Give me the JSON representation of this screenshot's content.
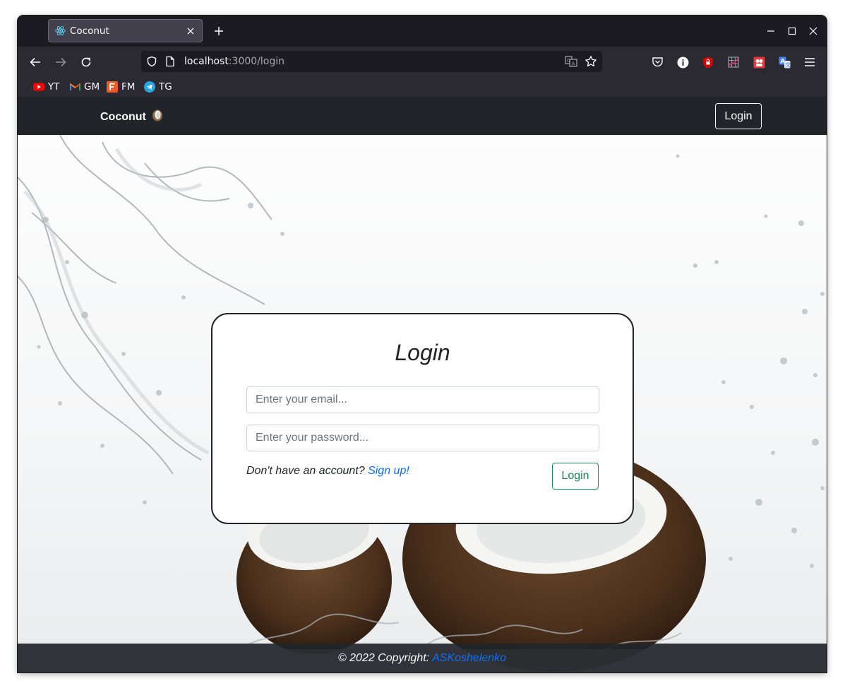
{
  "browser": {
    "tab": {
      "title": "Coconut",
      "favicon": "react-logo-icon"
    },
    "url": {
      "host": "localhost",
      "rest": ":3000/login"
    },
    "bookmarks": [
      {
        "label": "YT",
        "icon": "youtube-icon",
        "color": "#ff0000"
      },
      {
        "label": "GM",
        "icon": "gmail-icon",
        "color": "#ea4335"
      },
      {
        "label": "FM",
        "icon": "fm-icon",
        "color": "#f15a24"
      },
      {
        "label": "TG",
        "icon": "telegram-icon",
        "color": "#2aa3df"
      }
    ]
  },
  "app": {
    "brand": "Coconut",
    "nav_login": "Login",
    "card": {
      "title": "Login",
      "email_placeholder": "Enter your email...",
      "password_placeholder": "Enter your password...",
      "signup_prompt": "Don't have an account?",
      "signup_link": "Sign up!",
      "login_button": "Login"
    },
    "footer": {
      "copyright": "© 2022 Copyright:",
      "author": "ASKoshelenko"
    }
  },
  "colors": {
    "navbar": "#212529",
    "link": "#0d6efd",
    "success": "#198754"
  }
}
